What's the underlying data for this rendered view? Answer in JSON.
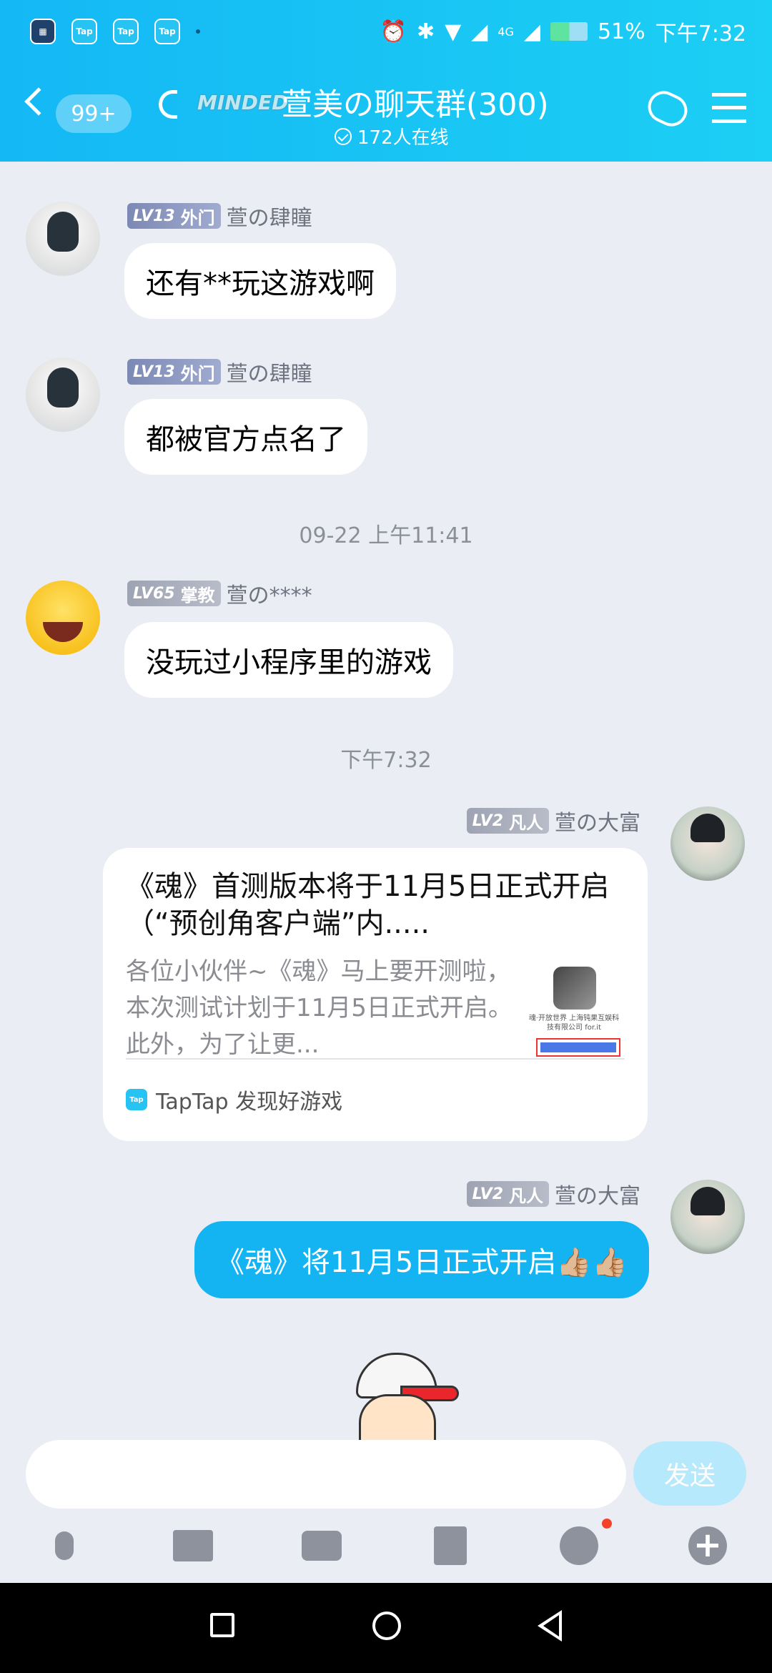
{
  "status_bar": {
    "app_icons": [
      "Tap",
      "Tap",
      "Tap"
    ],
    "network": "4G",
    "battery": "51%",
    "time": "下午7:32"
  },
  "header": {
    "unread_count": "99+",
    "group_prefix": "MINDED",
    "group_title": "萱美の聊天群(300)",
    "online": "172人在线"
  },
  "messages": [
    {
      "level": "LV13",
      "rank": "外门",
      "nick": "萱の肆瞳",
      "text": "还有**玩这游戏啊"
    },
    {
      "level": "LV13",
      "rank": "外门",
      "nick": "萱の肆瞳",
      "text": "都被官方点名了"
    },
    {
      "time": "09-22 上午11:41"
    },
    {
      "level": "LV65",
      "rank": "掌教",
      "nick": "萱の****",
      "text": "没玩过小程序里的游戏"
    },
    {
      "time": "下午7:32"
    },
    {
      "level": "LV2",
      "rank": "凡人",
      "nick": "萱の大富",
      "card": {
        "title": "《魂》首测版本将于11月5日正式开启（“预创角客户端”内.....",
        "desc": "各位小伙伴~《魂》马上要开测啦，本次测试计划于11月5日正式开启。此外，为了让更...",
        "thumb_text": "魂·开放世界 上海钝果互娱科技有限公司 for.it",
        "source": "TapTap 发现好游戏"
      }
    },
    {
      "level": "LV2",
      "rank": "凡人",
      "nick": "萱の大富",
      "text": "《魂》将11月5日正式开启👍🏼👍🏼"
    }
  ],
  "input": {
    "send_label": "发送"
  }
}
